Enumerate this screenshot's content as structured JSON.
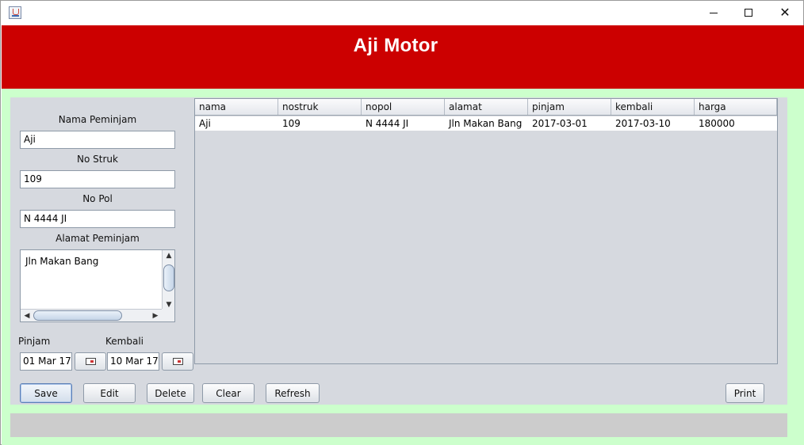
{
  "window": {
    "icon": "java-cup-icon",
    "controls": {
      "minimize": "minimize-icon",
      "maximize": "maximize-icon",
      "close": "close-icon"
    }
  },
  "header": {
    "title": "Aji Motor",
    "color": "#cc0000"
  },
  "form": {
    "nama_label": "Nama Peminjam",
    "nama_value": "Aji",
    "struk_label": "No Struk",
    "struk_value": "109",
    "nopol_label": "No Pol",
    "nopol_value": "N 4444 JI",
    "alamat_label": "Alamat Peminjam",
    "alamat_value": "Jln Makan Bang",
    "pinjam_label": "Pinjam",
    "pinjam_value": "01 Mar 17",
    "kembali_label": "Kembali",
    "kembali_value": "10 Mar 17"
  },
  "table": {
    "columns": [
      "nama",
      "nostruk",
      "nopol",
      "alamat",
      "pinjam",
      "kembali",
      "harga"
    ],
    "rows": [
      [
        "Aji",
        "109",
        "N 4444 JI",
        "Jln Makan Bang",
        "2017-03-01",
        "2017-03-10",
        "180000"
      ]
    ]
  },
  "buttons": {
    "save": "Save",
    "edit": "Edit",
    "delete": "Delete",
    "clear": "Clear",
    "refresh": "Refresh",
    "print": "Print"
  },
  "colors": {
    "frame": "#ccffcc",
    "panel": "#d6d9df",
    "status_bar": "#cccccc"
  }
}
